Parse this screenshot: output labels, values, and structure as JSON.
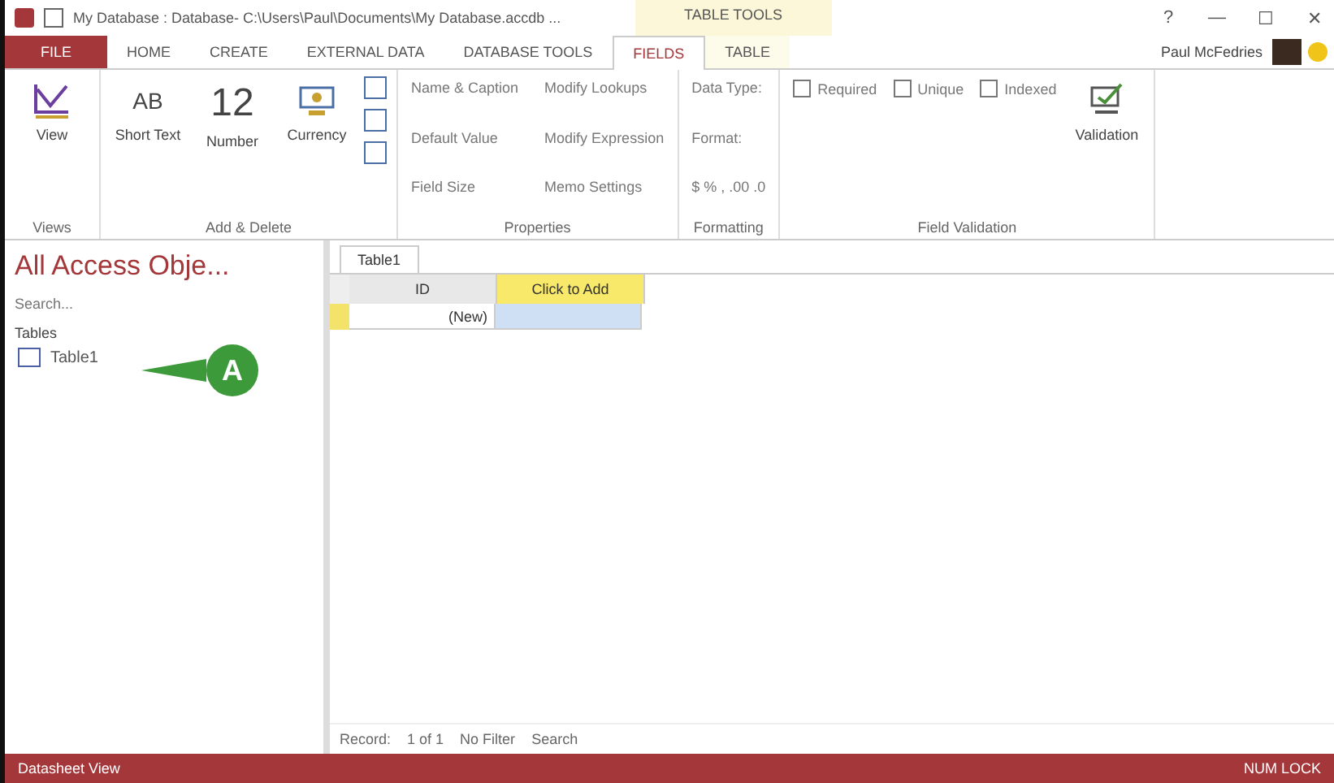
{
  "window": {
    "title": "My Database : Database- C:\\Users\\Paul\\Documents\\My Database.accdb ...",
    "context_label": "TABLE TOOLS",
    "controls": [
      "?",
      "—",
      "☐",
      "✕"
    ]
  },
  "tabs": [
    {
      "label": "FILE",
      "kind": "file",
      "selected": false
    },
    {
      "label": "HOME",
      "kind": "tab",
      "selected": false
    },
    {
      "label": "CREATE",
      "kind": "tab",
      "selected": false
    },
    {
      "label": "EXTERNAL DATA",
      "kind": "tab",
      "selected": false
    },
    {
      "label": "DATABASE TOOLS",
      "kind": "tab",
      "selected": false
    },
    {
      "label": "FIELDS",
      "kind": "context",
      "selected": true
    },
    {
      "label": "TABLE",
      "kind": "context",
      "selected": false
    }
  ],
  "user": {
    "name": "Paul McFedries"
  },
  "ribbon": {
    "groups": [
      {
        "label": "Views",
        "items": [
          {
            "kind": "big",
            "label": "View"
          }
        ]
      },
      {
        "label": "Add & Delete",
        "items": [
          {
            "kind": "glyph",
            "glyph": "AB",
            "label": "Short Text"
          },
          {
            "kind": "glyph",
            "glyph": "12",
            "label": "Number"
          },
          {
            "kind": "big",
            "label": "Currency"
          },
          {
            "kind": "small-icons"
          }
        ]
      },
      {
        "label": "Properties",
        "items": [
          {
            "kind": "small",
            "label": "Name & Caption"
          },
          {
            "kind": "small",
            "label": "Default Value"
          },
          {
            "kind": "small",
            "label": "Field Size"
          },
          {
            "kind": "small",
            "label": "Modify Lookups"
          },
          {
            "kind": "small",
            "label": "Modify Expression"
          },
          {
            "kind": "small",
            "label": "Memo Settings"
          }
        ]
      },
      {
        "label": "Formatting",
        "items": [
          {
            "kind": "small",
            "label": "Data Type:"
          },
          {
            "kind": "small",
            "label": "Format:"
          },
          {
            "kind": "small",
            "label": "$ % , .00 .0"
          }
        ]
      },
      {
        "label": "Field Validation",
        "items": [
          {
            "kind": "check",
            "label": "Required",
            "checked": false
          },
          {
            "kind": "check",
            "label": "Unique",
            "checked": false
          },
          {
            "kind": "check",
            "label": "Indexed",
            "checked": false
          },
          {
            "kind": "big",
            "label": "Validation"
          }
        ]
      }
    ]
  },
  "nav_pane": {
    "title": "All Access Obje...",
    "search": {
      "placeholder": "Search..."
    },
    "section": "Tables",
    "items": [
      {
        "label": "Table1",
        "selected": false
      }
    ]
  },
  "callout": {
    "label": "A"
  },
  "document": {
    "tab": "Table1",
    "columns": [
      "ID",
      "Click to Add"
    ],
    "rows": [
      {
        "cells": [
          "(New)",
          ""
        ]
      }
    ],
    "record_nav": {
      "label": "Record:",
      "position": "1 of 1",
      "filter": "No Filter",
      "search": "Search"
    }
  },
  "status_bar": {
    "left": "Datasheet View",
    "right": "NUM LOCK"
  }
}
